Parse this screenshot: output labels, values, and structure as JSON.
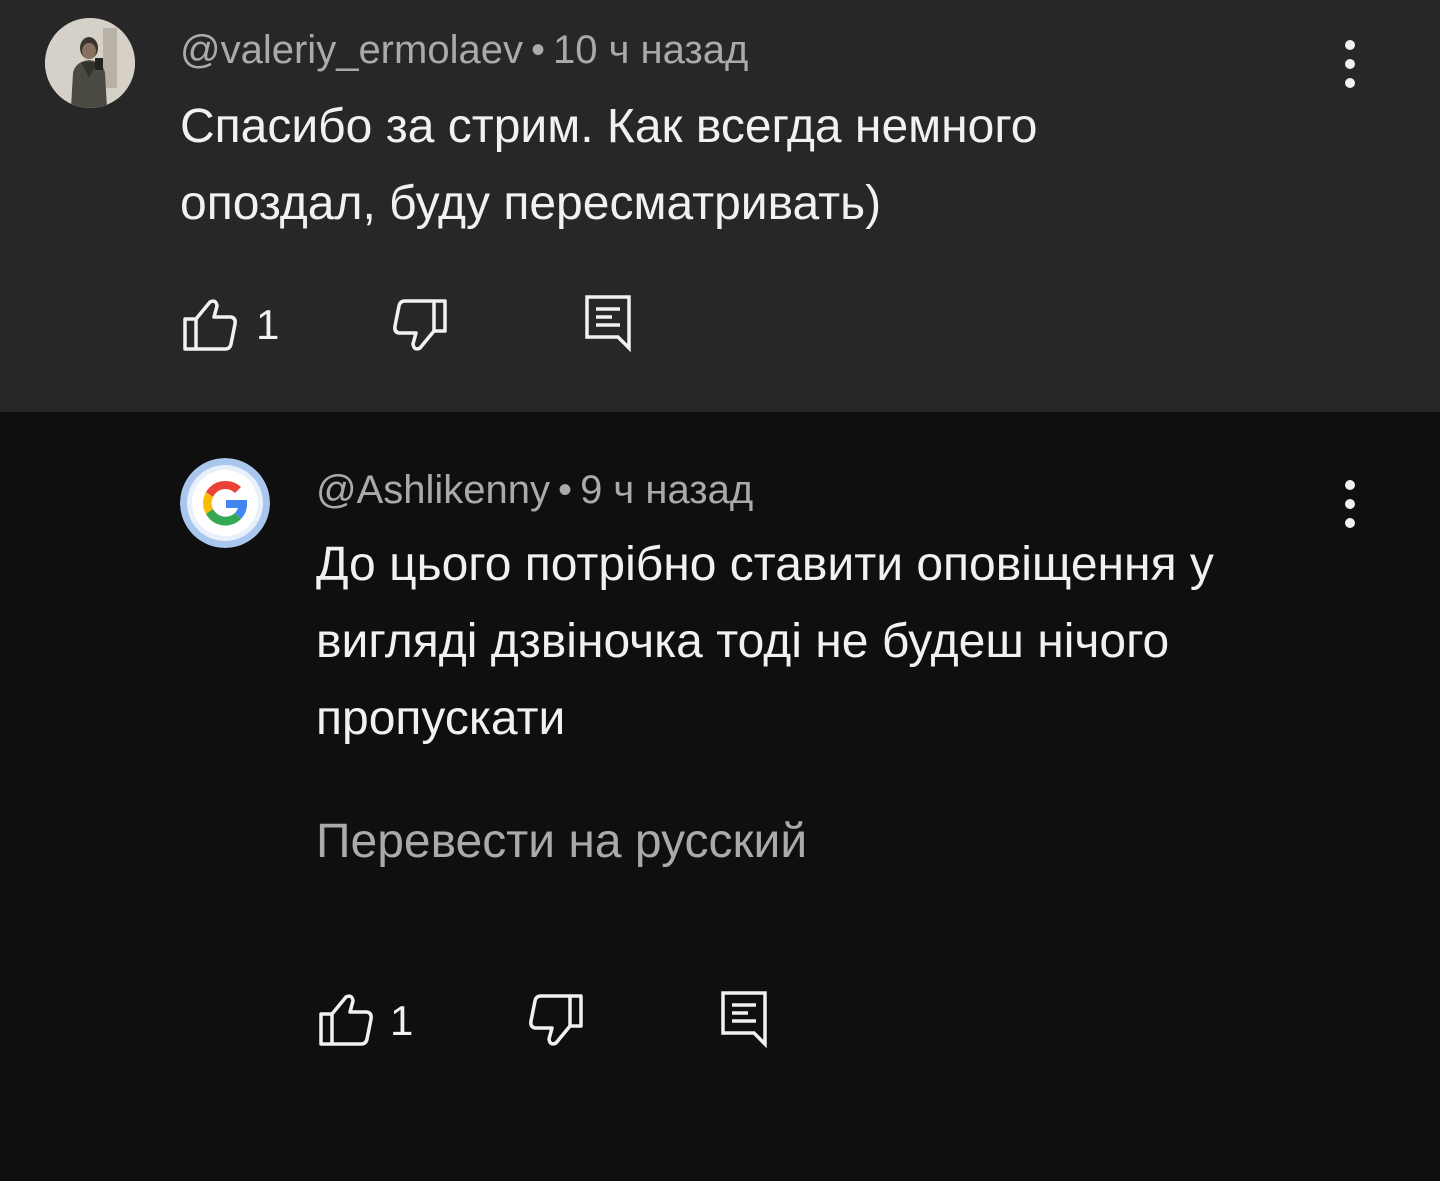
{
  "comments": [
    {
      "author": "@valeriy_ermolaev",
      "separator": "•",
      "time": "10 ч назад",
      "text_lines": [
        "Спасибо за стрим. Как всегда немного",
        "опоздал, буду пересматривать)"
      ],
      "likes": "1",
      "avatar": "user-photo"
    },
    {
      "author": "@Ashlikenny",
      "separator": "•",
      "time": "9 ч назад",
      "text_lines": [
        "До цього потрібно ставити оповіщення у",
        "вигляді дзвіночка тоді не будеш нічого",
        "пропускати"
      ],
      "translate_label": "Перевести на русский",
      "likes": "1",
      "avatar": "google-g-logo"
    }
  ],
  "icons": {
    "like": "thumb-up-icon",
    "dislike": "thumb-down-icon",
    "reply": "reply-comment-icon",
    "more": "more-vertical-icon"
  },
  "colors": {
    "top_comment_bg": "#272727",
    "reply_bg": "#0f0f0f",
    "text_primary": "#f1f1f1",
    "text_secondary": "#aaaaaa"
  }
}
